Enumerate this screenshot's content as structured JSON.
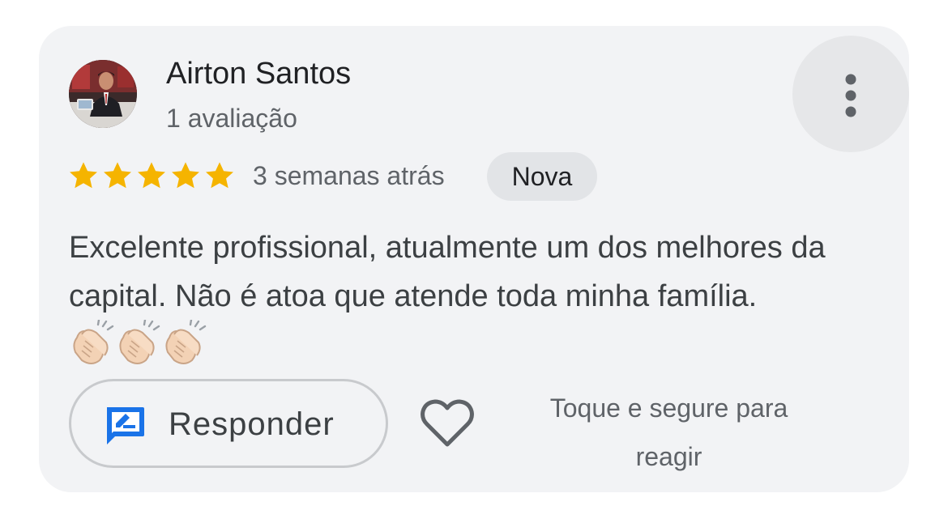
{
  "review": {
    "author": "Airton Santos",
    "review_count": "1 avaliação",
    "rating": 5,
    "date": "3 semanas atrás",
    "badge": "Nova",
    "text": "Excelente profissional, atualmente um dos melhores da capital. Não é atoa que atende toda minha família."
  },
  "actions": {
    "reply_label": "Responder",
    "hint": "Toque e segure para reagir"
  },
  "icons": {
    "more": "more-vert-icon",
    "star": "star-icon",
    "reply": "reply-icon",
    "like": "heart-icon",
    "emoji": "clapping-hands-emoji"
  },
  "colors": {
    "star": "#F5B400",
    "accent": "#1A73E8",
    "card_bg": "#F2F3F5"
  }
}
